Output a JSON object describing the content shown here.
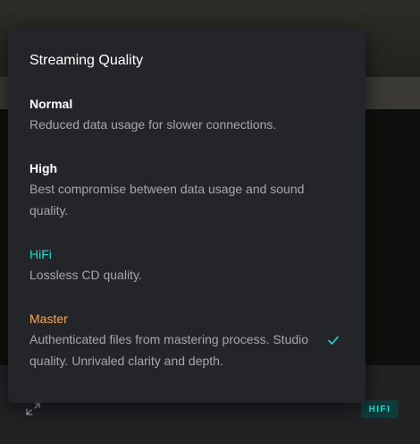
{
  "menu": {
    "title": "Streaming Quality",
    "options": [
      {
        "name": "Normal",
        "description": "Reduced data usage for slower connections.",
        "selected": false
      },
      {
        "name": "High",
        "description": "Best compromise between data usage and sound quality.",
        "selected": false
      },
      {
        "name": "HiFi",
        "description": "Lossless CD quality.",
        "selected": false,
        "name_color": "#1fd9d6"
      },
      {
        "name": "Master",
        "description": "Authenticated files from mastering process. Studio quality. Unrivaled clarity and depth.",
        "selected": true,
        "name_color": "#f5a660"
      }
    ],
    "selected_icon": "checkmark-icon"
  },
  "player_bar": {
    "expand_icon": "expand-arrows-icon",
    "quality_badge": "HIFI"
  },
  "colors": {
    "menu_background": "#242528",
    "hifi_accent": "#1fd9d6",
    "master_accent": "#f5a660",
    "badge_background": "#0f3b3b",
    "check_color": "#1fd9d6"
  }
}
